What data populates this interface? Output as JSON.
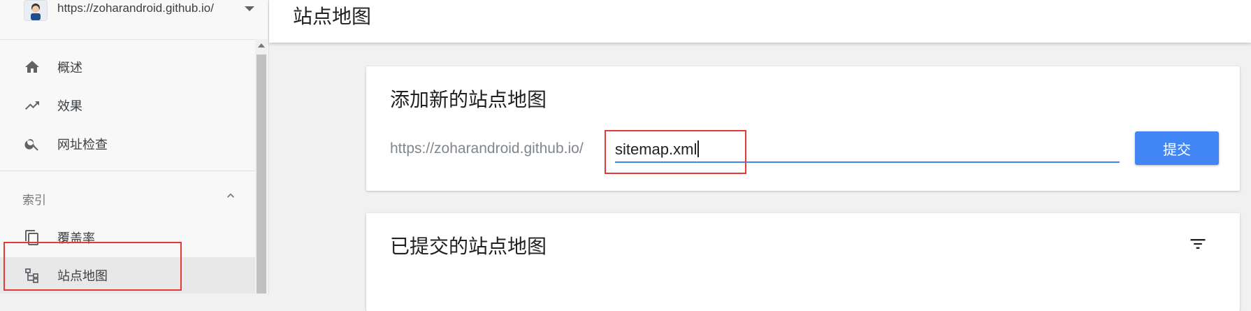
{
  "property": {
    "url": "https://zoharandroid.github.io/"
  },
  "nav": {
    "items": [
      {
        "label": "概述",
        "icon": "home-icon"
      },
      {
        "label": "效果",
        "icon": "trending-up-icon"
      },
      {
        "label": "网址检查",
        "icon": "search-icon"
      }
    ],
    "section": {
      "label": "索引"
    },
    "index_items": [
      {
        "label": "覆盖率",
        "icon": "copy-icon"
      },
      {
        "label": "站点地图",
        "icon": "sitemap-icon",
        "active": true
      }
    ]
  },
  "header": {
    "title": "站点地图"
  },
  "add_card": {
    "title": "添加新的站点地图",
    "prefix": "https://zoharandroid.github.io/",
    "input_value": "sitemap.xml",
    "submit_label": "提交"
  },
  "submitted_card": {
    "title": "已提交的站点地图"
  },
  "colors": {
    "accent": "#4285f4",
    "highlight": "#e53935"
  }
}
